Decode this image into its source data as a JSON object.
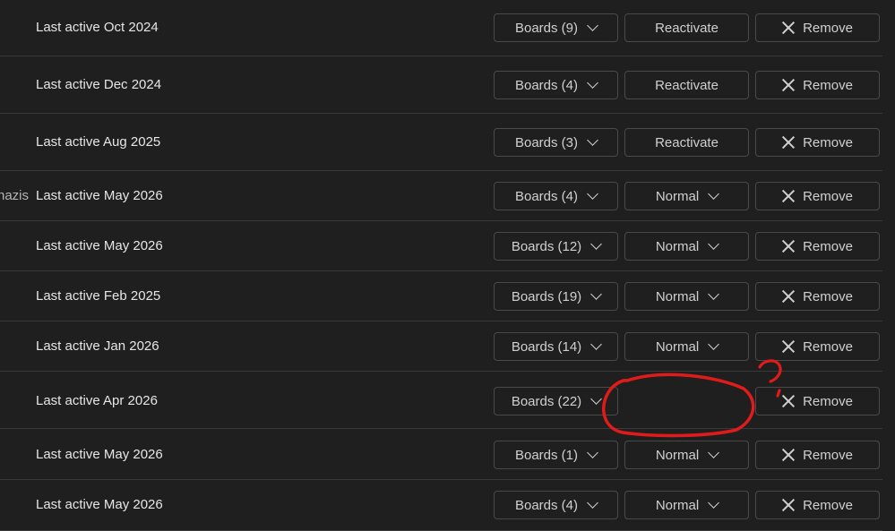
{
  "rows": [
    {
      "truncated_text": "",
      "last_active": "Last active Oct 2024",
      "boards_label": "Boards (9)",
      "status_label": "Reactivate",
      "status_type": "button",
      "remove_label": "Remove"
    },
    {
      "truncated_text": "",
      "last_active": "Last active Dec 2024",
      "boards_label": "Boards (4)",
      "status_label": "Reactivate",
      "status_type": "button",
      "remove_label": "Remove"
    },
    {
      "truncated_text": "",
      "last_active": "Last active Aug 2025",
      "boards_label": "Boards (3)",
      "status_label": "Reactivate",
      "status_type": "button",
      "remove_label": "Remove"
    },
    {
      "truncated_text": "nazis",
      "last_active": "Last active May 2026",
      "boards_label": "Boards (4)",
      "status_label": "Normal",
      "status_type": "dropdown",
      "remove_label": "Remove"
    },
    {
      "truncated_text": "",
      "last_active": "Last active May 2026",
      "boards_label": "Boards (12)",
      "status_label": "Normal",
      "status_type": "dropdown",
      "remove_label": "Remove"
    },
    {
      "truncated_text": "",
      "last_active": "Last active Feb 2025",
      "boards_label": "Boards (19)",
      "status_label": "Normal",
      "status_type": "dropdown",
      "remove_label": "Remove"
    },
    {
      "truncated_text": "",
      "last_active": "Last active Jan 2026",
      "boards_label": "Boards (14)",
      "status_label": "Normal",
      "status_type": "dropdown",
      "remove_label": "Remove"
    },
    {
      "truncated_text": "",
      "last_active": "Last active Apr 2026",
      "boards_label": "Boards (22)",
      "status_label": "",
      "status_type": "missing",
      "remove_label": "Remove"
    },
    {
      "truncated_text": "",
      "last_active": "Last active May 2026",
      "boards_label": "Boards (1)",
      "status_label": "Normal",
      "status_type": "dropdown",
      "remove_label": "Remove"
    },
    {
      "truncated_text": "",
      "last_active": "Last active May 2026",
      "boards_label": "Boards (4)",
      "status_label": "Normal",
      "status_type": "dropdown",
      "remove_label": "Remove"
    }
  ],
  "annotation": {
    "mark": "?",
    "color": "#e01b1b"
  },
  "colors": {
    "background": "#1f1f1f",
    "text": "#e6e6e6",
    "button_border": "#4a4a4a"
  }
}
